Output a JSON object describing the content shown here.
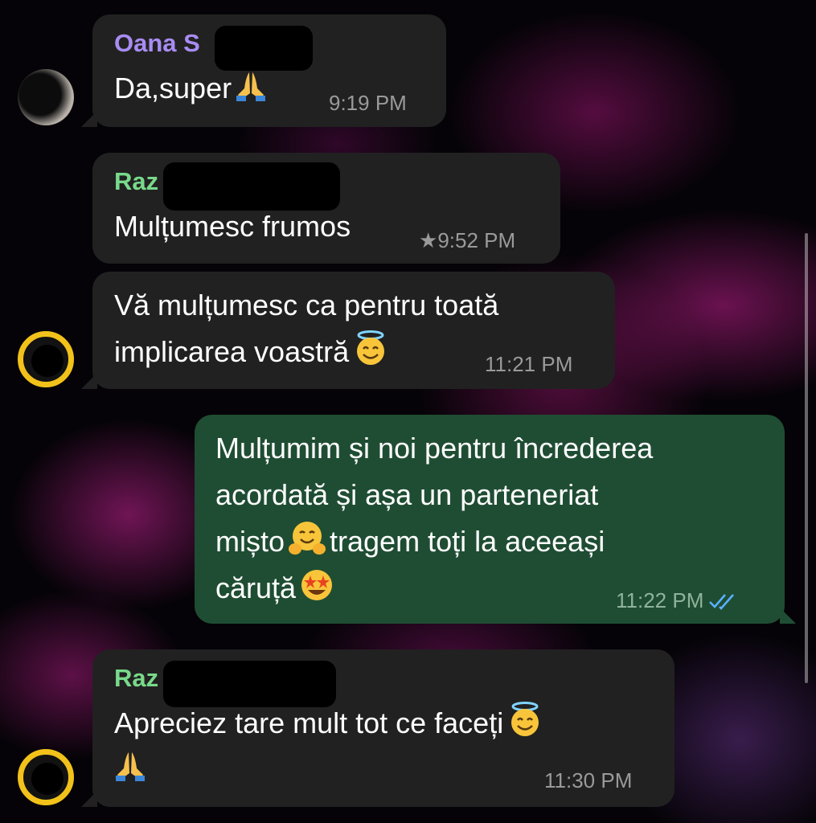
{
  "messages": [
    {
      "sender": "Oana S",
      "text_lines": [
        "Da,super"
      ],
      "emojis": [
        "folded-hands"
      ],
      "time": "9:19 PM",
      "direction": "incoming"
    },
    {
      "sender": "Raz",
      "text_lines": [
        "Mulțumesc frumos"
      ],
      "starred": true,
      "star_glyph": "★",
      "time": "9:52 PM",
      "direction": "incoming"
    },
    {
      "sender": "",
      "text_lines": [
        "Vă mulțumesc ca pentru toată",
        "implicarea voastră"
      ],
      "emojis": [
        "smiling-face-with-halo"
      ],
      "time": "11:21 PM",
      "direction": "incoming"
    },
    {
      "sender": "",
      "text_lines": [
        "Mulțumim și noi pentru încrederea",
        "acordată și așa un parteneriat",
        "mișto",
        "tragem toți la aceeași",
        "căruță"
      ],
      "emojis": [
        "hugging-face",
        "star-struck"
      ],
      "time": "11:22 PM",
      "direction": "outgoing",
      "status": "read-double-check"
    },
    {
      "sender": "Raz",
      "text_lines": [
        "Apreciez tare mult tot ce faceți"
      ],
      "emojis": [
        "smiling-face-with-halo",
        "folded-hands"
      ],
      "time": "11:30 PM",
      "direction": "incoming"
    }
  ],
  "colors": {
    "incoming_bubble": "#212121",
    "outgoing_bubble": "#1f4d33",
    "sender_purple": "#a88cf2",
    "sender_green": "#78d98a",
    "read_check": "#5ab0ff",
    "avatar_ring": "#f2c21a"
  }
}
